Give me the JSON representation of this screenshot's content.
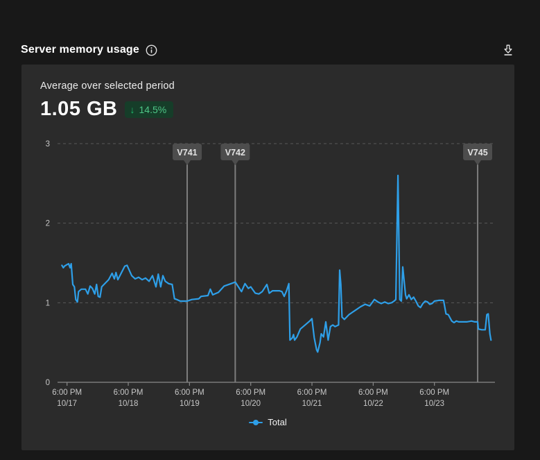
{
  "header": {
    "title": "Server memory usage"
  },
  "summary": {
    "label": "Average over selected period",
    "value": "1.05 GB",
    "delta": "14.5%",
    "delta_direction": "down",
    "delta_arrow": "↓"
  },
  "legend": {
    "total_label": "Total"
  },
  "colors": {
    "page_bg": "#181818",
    "card_bg": "#2b2b2b",
    "line": "#2e9fe8",
    "grid": "#5a5a5a",
    "axis_line": "#8a8a8a",
    "axis_text": "#c7c7c7",
    "marker_line": "#7d7d7d",
    "flag_bg": "#4d4d4d",
    "flag_text": "#e2e2e2",
    "badge_bg": "#163d29",
    "badge_green": "#1fbd6e"
  },
  "chart_data": {
    "type": "line",
    "title": "Server memory usage",
    "unit": "GB",
    "ylim": [
      0,
      3
    ],
    "yticks": [
      0,
      1,
      2,
      3
    ],
    "grid": "dashed-horizontal",
    "legend_position": "bottom-center",
    "x_ticks": [
      {
        "time": "6:00 PM",
        "date": "10/17"
      },
      {
        "time": "6:00 PM",
        "date": "10/18"
      },
      {
        "time": "6:00 PM",
        "date": "10/19"
      },
      {
        "time": "6:00 PM",
        "date": "10/20"
      },
      {
        "time": "6:00 PM",
        "date": "10/21"
      },
      {
        "time": "6:00 PM",
        "date": "10/22"
      },
      {
        "time": "6:00 PM",
        "date": "10/23"
      }
    ],
    "markers": [
      {
        "label": "V741",
        "t": 1.962
      },
      {
        "label": "V742",
        "t": 2.747
      },
      {
        "label": "V745",
        "t": 6.706
      }
    ],
    "legend": [
      {
        "name": "Total",
        "color": "#2e9fe8"
      }
    ],
    "series": [
      {
        "name": "Total",
        "points": [
          [
            -0.084,
            1.47
          ],
          [
            -0.06,
            1.44
          ],
          [
            -0.042,
            1.46
          ],
          [
            0.0,
            1.48
          ],
          [
            0.026,
            1.49
          ],
          [
            0.05,
            1.44
          ],
          [
            0.068,
            1.49
          ],
          [
            0.094,
            1.23
          ],
          [
            0.12,
            1.2
          ],
          [
            0.143,
            1.04
          ],
          [
            0.17,
            1.01
          ],
          [
            0.188,
            1.14
          ],
          [
            0.233,
            1.17
          ],
          [
            0.301,
            1.17
          ],
          [
            0.34,
            1.11
          ],
          [
            0.377,
            1.21
          ],
          [
            0.414,
            1.18
          ],
          [
            0.453,
            1.11
          ],
          [
            0.482,
            1.23
          ],
          [
            0.51,
            1.08
          ],
          [
            0.539,
            1.07
          ],
          [
            0.566,
            1.2
          ],
          [
            0.679,
            1.29
          ],
          [
            0.736,
            1.37
          ],
          [
            0.773,
            1.3
          ],
          [
            0.799,
            1.38
          ],
          [
            0.83,
            1.29
          ],
          [
            0.943,
            1.46
          ],
          [
            0.98,
            1.47
          ],
          [
            1.056,
            1.34
          ],
          [
            1.113,
            1.3
          ],
          [
            1.17,
            1.32
          ],
          [
            1.226,
            1.29
          ],
          [
            1.283,
            1.31
          ],
          [
            1.34,
            1.27
          ],
          [
            1.396,
            1.34
          ],
          [
            1.453,
            1.2
          ],
          [
            1.49,
            1.36
          ],
          [
            1.529,
            1.2
          ],
          [
            1.566,
            1.34
          ],
          [
            1.604,
            1.27
          ],
          [
            1.66,
            1.24
          ],
          [
            1.717,
            1.23
          ],
          [
            1.755,
            1.05
          ],
          [
            1.793,
            1.04
          ],
          [
            1.849,
            1.02
          ],
          [
            1.962,
            1.02
          ],
          [
            2.038,
            1.04
          ],
          [
            2.152,
            1.05
          ],
          [
            2.189,
            1.08
          ],
          [
            2.302,
            1.09
          ],
          [
            2.34,
            1.17
          ],
          [
            2.38,
            1.1
          ],
          [
            2.472,
            1.13
          ],
          [
            2.566,
            1.21
          ],
          [
            2.679,
            1.24
          ],
          [
            2.747,
            1.26
          ],
          [
            2.849,
            1.14
          ],
          [
            2.906,
            1.24
          ],
          [
            2.962,
            1.18
          ],
          [
            3.0,
            1.2
          ],
          [
            3.075,
            1.12
          ],
          [
            3.132,
            1.11
          ],
          [
            3.188,
            1.14
          ],
          [
            3.264,
            1.23
          ],
          [
            3.302,
            1.12
          ],
          [
            3.355,
            1.15
          ],
          [
            3.468,
            1.15
          ],
          [
            3.51,
            1.14
          ],
          [
            3.547,
            1.08
          ],
          [
            3.585,
            1.15
          ],
          [
            3.623,
            1.24
          ],
          [
            3.641,
            0.53
          ],
          [
            3.68,
            0.56
          ],
          [
            3.698,
            0.6
          ],
          [
            3.717,
            0.53
          ],
          [
            3.755,
            0.57
          ],
          [
            3.811,
            0.67
          ],
          [
            3.887,
            0.72
          ],
          [
            3.963,
            0.77
          ],
          [
            4.0,
            0.8
          ],
          [
            4.037,
            0.56
          ],
          [
            4.075,
            0.41
          ],
          [
            4.094,
            0.38
          ],
          [
            4.132,
            0.5
          ],
          [
            4.151,
            0.61
          ],
          [
            4.189,
            0.57
          ],
          [
            4.226,
            0.76
          ],
          [
            4.264,
            0.53
          ],
          [
            4.302,
            0.7
          ],
          [
            4.34,
            0.72
          ],
          [
            4.377,
            0.7
          ],
          [
            4.434,
            0.72
          ],
          [
            4.453,
            1.41
          ],
          [
            4.472,
            1.23
          ],
          [
            4.491,
            0.82
          ],
          [
            4.53,
            0.79
          ],
          [
            4.604,
            0.85
          ],
          [
            4.66,
            0.88
          ],
          [
            4.717,
            0.91
          ],
          [
            4.793,
            0.95
          ],
          [
            4.868,
            0.98
          ],
          [
            4.944,
            0.96
          ],
          [
            5.02,
            1.04
          ],
          [
            5.076,
            1.01
          ],
          [
            5.132,
            0.99
          ],
          [
            5.189,
            1.01
          ],
          [
            5.245,
            0.99
          ],
          [
            5.302,
            1.0
          ],
          [
            5.34,
            1.02
          ],
          [
            5.37,
            1.04
          ],
          [
            5.404,
            2.6
          ],
          [
            5.434,
            1.04
          ],
          [
            5.46,
            1.02
          ],
          [
            5.483,
            1.45
          ],
          [
            5.528,
            1.1
          ],
          [
            5.547,
            1.05
          ],
          [
            5.585,
            1.1
          ],
          [
            5.622,
            1.04
          ],
          [
            5.66,
            1.07
          ],
          [
            5.698,
            1.02
          ],
          [
            5.736,
            0.96
          ],
          [
            5.773,
            0.94
          ],
          [
            5.811,
            0.99
          ],
          [
            5.849,
            1.02
          ],
          [
            5.887,
            1.01
          ],
          [
            5.924,
            0.98
          ],
          [
            5.962,
            0.99
          ],
          [
            6.0,
            1.02
          ],
          [
            6.07,
            1.03
          ],
          [
            6.15,
            1.03
          ],
          [
            6.189,
            0.86
          ],
          [
            6.226,
            0.85
          ],
          [
            6.283,
            0.77
          ],
          [
            6.32,
            0.75
          ],
          [
            6.358,
            0.77
          ],
          [
            6.396,
            0.76
          ],
          [
            6.453,
            0.76
          ],
          [
            6.528,
            0.76
          ],
          [
            6.604,
            0.77
          ],
          [
            6.66,
            0.76
          ],
          [
            6.706,
            0.76
          ],
          [
            6.717,
            0.67
          ],
          [
            6.773,
            0.66
          ],
          [
            6.83,
            0.66
          ],
          [
            6.856,
            0.85
          ],
          [
            6.879,
            0.86
          ],
          [
            6.906,
            0.61
          ],
          [
            6.924,
            0.53
          ]
        ]
      }
    ]
  }
}
